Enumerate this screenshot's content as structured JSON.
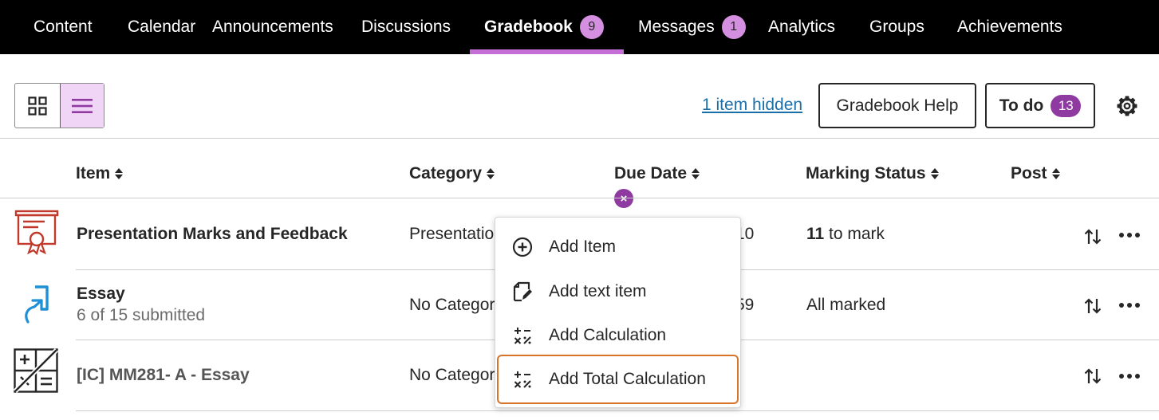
{
  "nav": {
    "items": [
      {
        "label": "Content"
      },
      {
        "label": "Calendar"
      },
      {
        "label": "Announcements"
      },
      {
        "label": "Discussions"
      },
      {
        "label": "Gradebook",
        "badge": "9",
        "active": true
      },
      {
        "label": "Messages",
        "badge": "1"
      },
      {
        "label": "Analytics"
      },
      {
        "label": "Groups"
      },
      {
        "label": "Achievements"
      }
    ]
  },
  "toolbar": {
    "grid_view_icon": "grid-icon",
    "list_view_icon": "list-icon",
    "hidden_link": "1 item hidden",
    "help_label": "Gradebook Help",
    "todo_label": "To do",
    "todo_count": "13",
    "settings_icon": "gear-icon"
  },
  "table": {
    "columns": [
      "Item",
      "Category",
      "Due Date",
      "Marking Status",
      "Post"
    ],
    "rows": [
      {
        "icon": "presentation-icon",
        "title": "Presentation Marks and Feedback",
        "category": "Presentatio",
        "due": "10",
        "status_count": "11",
        "status_text": " to mark"
      },
      {
        "icon": "assignment-icon",
        "title": "Essay",
        "subtitle": "6 of 15 submitted",
        "category": "No Categor",
        "due": "59",
        "status_text": "All marked"
      },
      {
        "icon": "calculation-icon",
        "title": "[IC] MM281- A - Essay",
        "category": "No Categor"
      }
    ]
  },
  "menu": {
    "items": [
      {
        "label": "Add Item",
        "icon": "add-circle-icon"
      },
      {
        "label": "Add text item",
        "icon": "edit-note-icon"
      },
      {
        "label": "Add Calculation",
        "icon": "calculator-icon"
      },
      {
        "label": "Add Total Calculation",
        "icon": "calculator-icon"
      }
    ]
  },
  "colors": {
    "nav_bg": "#000000",
    "accent": "#8e3aa0",
    "badge": "#d58fe0",
    "link": "#1a6fa8",
    "focus_ring": "#d8742a",
    "presentation_icon": "#c0392b",
    "assignment_icon": "#1e90d6"
  }
}
